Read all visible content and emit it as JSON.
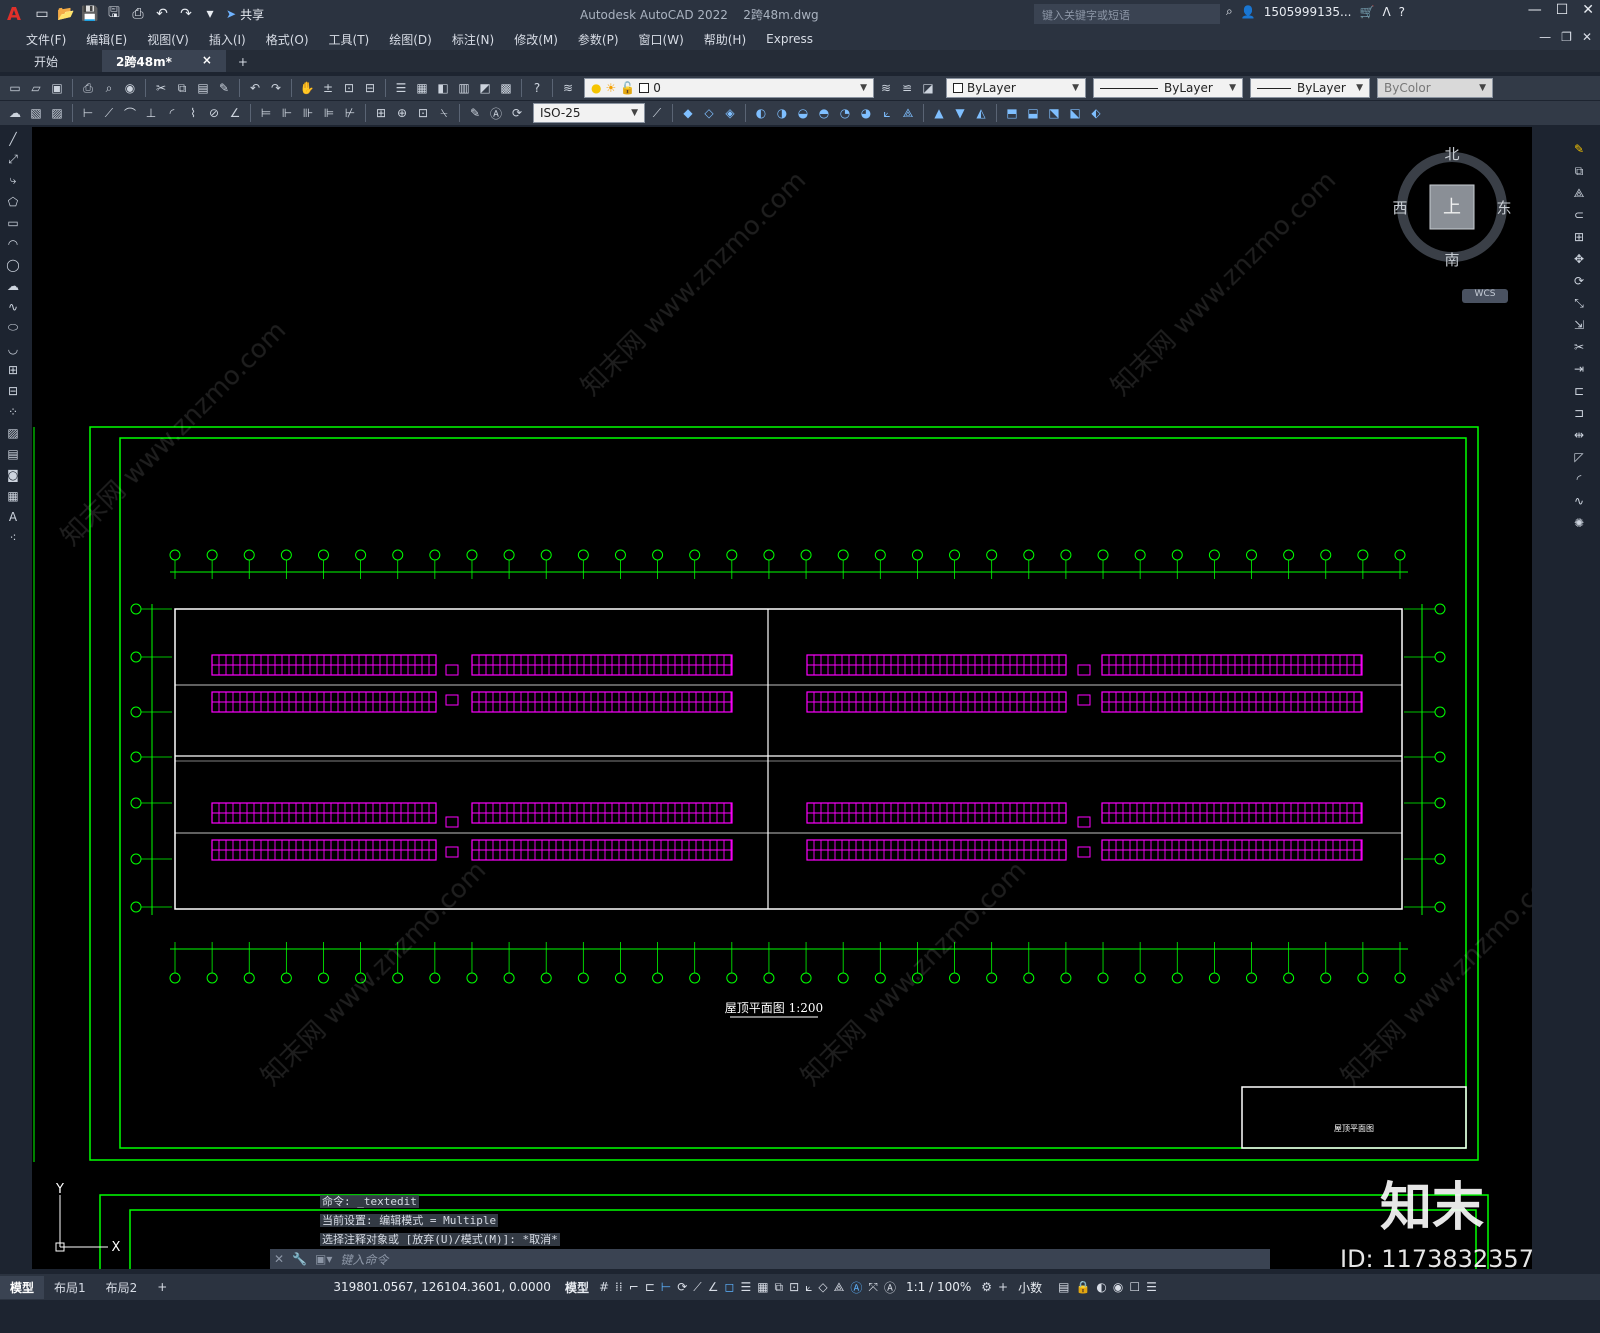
{
  "app": {
    "title": "Autodesk AutoCAD 2022",
    "file": "2跨48m.dwg",
    "search_placeholder": "键入关键字或短语",
    "user": "1505999135...",
    "share_label": "共享"
  },
  "menus": [
    "文件(F)",
    "编辑(E)",
    "视图(V)",
    "插入(I)",
    "格式(O)",
    "工具(T)",
    "绘图(D)",
    "标注(N)",
    "修改(M)",
    "参数(P)",
    "窗口(W)",
    "帮助(H)",
    "Express"
  ],
  "tabs": {
    "start": "开始",
    "document": "2跨48m*",
    "close": "×",
    "add": "+"
  },
  "toolbar": {
    "layer_value": "0",
    "color": "ByLayer",
    "linetype": "ByLayer",
    "lineweight": "ByLayer",
    "plotstyle": "ByColor",
    "dimstyle": "ISO-25"
  },
  "viewcube": {
    "north": "北",
    "south": "南",
    "east": "东",
    "west": "西",
    "top": "上",
    "wcs": "WCS"
  },
  "drawing": {
    "title": "屋顶平面图 1:200",
    "titleblock_label": "屋顶平面图",
    "colors": {
      "frame": "#00ff00",
      "panels": "#ff00ff",
      "lines": "#ffffff"
    }
  },
  "ucs": {
    "y": "Y",
    "x": "X"
  },
  "command": {
    "line1": "命令: _textedit",
    "line2": "当前设置: 编辑模式 = Multiple",
    "line3": "选择注释对象或 [放弃(U)/模式(M)]: *取消*",
    "placeholder": "键入命令"
  },
  "watermark": {
    "brand": "知末",
    "id": "ID: 1173832357",
    "site": "知末网 www.znzmo.com"
  },
  "status": {
    "layouts": [
      "模型",
      "布局1",
      "布局2"
    ],
    "add": "+",
    "coords": "319801.0567, 126104.3601, 0.0000",
    "mode": "模型",
    "scale": "1:1 / 100%",
    "units": "小数"
  }
}
